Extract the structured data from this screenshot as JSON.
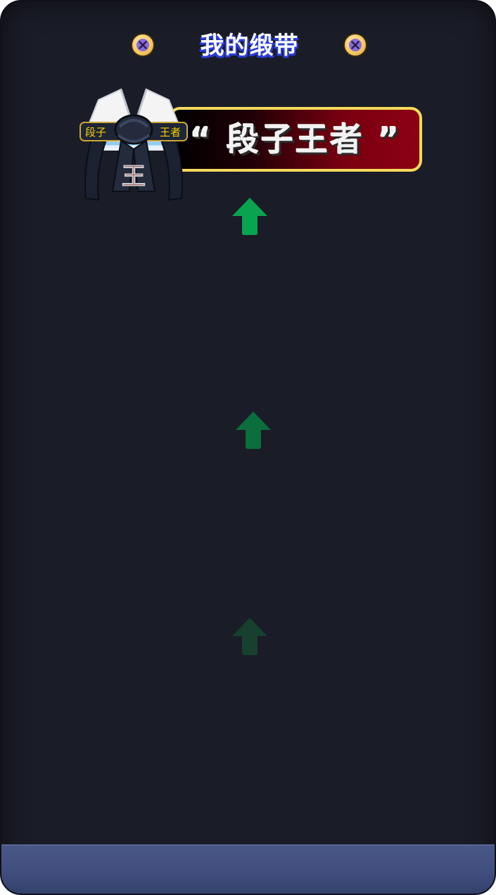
{
  "header": {
    "title": "我的缎带"
  },
  "badge": {
    "banner_text": "“ 段子王者 ”",
    "belt_label_left": "段子",
    "belt_label_right": "王者",
    "belt_vertical_left": "段子王者",
    "belt_vertical_right": "段子王者",
    "belt_center_char": "王"
  },
  "arrows": [
    {
      "name": "up-arrow-icon",
      "color": "#0aa34f"
    },
    {
      "name": "up-arrow-icon",
      "color": "#0b6e3c"
    },
    {
      "name": "up-arrow-icon",
      "color": "#17402e"
    }
  ],
  "colors": {
    "background": "#1a1c27",
    "banner_border": "#f5d95c",
    "banner_red": "#8c0012",
    "title_shadow": "#2b3dd8",
    "bottom_bar": "#4a5888",
    "belt_text": "#f5d000"
  }
}
